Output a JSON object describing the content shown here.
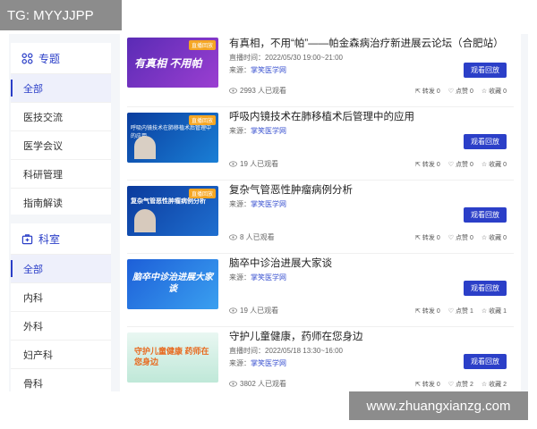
{
  "watermark_top": "TG: MYYJJPP",
  "watermark_bottom": "www.zhuangxianzg.com",
  "sidebar": {
    "topics_title": "专题",
    "topics": [
      "全部",
      "医技交流",
      "医学会议",
      "科研管理",
      "指南解读"
    ],
    "depts_title": "科室",
    "depts": [
      "全部",
      "内科",
      "外科",
      "妇产科",
      "骨科"
    ]
  },
  "cards": [
    {
      "title": "有真相，不用“帕”——帕金森病治疗新进展云论坛（合肥站）",
      "time": "直播时间：2022/05/30 19:00~21:00",
      "source_label": "来源：",
      "source": "掌笑医学网",
      "views": "2993 人已观看",
      "button": "观看回放",
      "share": "转发 0",
      "like": "点赞 0",
      "fav": "收藏 0",
      "thumb_text": "有真相 不用帕",
      "badge": "直播回放"
    },
    {
      "title": "呼吸内镜技术在肺移植术后管理中的应用",
      "time": "",
      "source_label": "来源：",
      "source": "掌笑医学网",
      "views": "19 人已观看",
      "button": "观看回放",
      "share": "转发 0",
      "like": "点赞 0",
      "fav": "收藏 0",
      "thumb_text": "呼吸内镜技术在肺移植术后管理中的应用",
      "badge": "直播回放"
    },
    {
      "title": "复杂气管恶性肿瘤病例分析",
      "time": "",
      "source_label": "来源：",
      "source": "掌笑医学网",
      "views": "8 人已观看",
      "button": "观看回放",
      "share": "转发 0",
      "like": "点赞 0",
      "fav": "收藏 0",
      "thumb_text": "复杂气管恶性肿瘤病例分析",
      "badge": "直播回放"
    },
    {
      "title": "脑卒中诊治进展大家谈",
      "time": "",
      "source_label": "来源：",
      "source": "掌笑医学网",
      "views": "19 人已观看",
      "button": "观看回放",
      "share": "转发 0",
      "like": "点赞 1",
      "fav": "收藏 1",
      "thumb_text": "脑卒中诊治进展大家谈",
      "badge": ""
    },
    {
      "title": "守护儿童健康，药师在您身边",
      "time": "直播时间：2022/05/18 13:30~16:00",
      "source_label": "来源：",
      "source": "掌笑医学网",
      "views": "3802 人已观看",
      "button": "观看回放",
      "share": "转发 0",
      "like": "点赞 2",
      "fav": "收藏 2",
      "thumb_text": "守护儿童健康 药师在您身边",
      "badge": ""
    }
  ]
}
